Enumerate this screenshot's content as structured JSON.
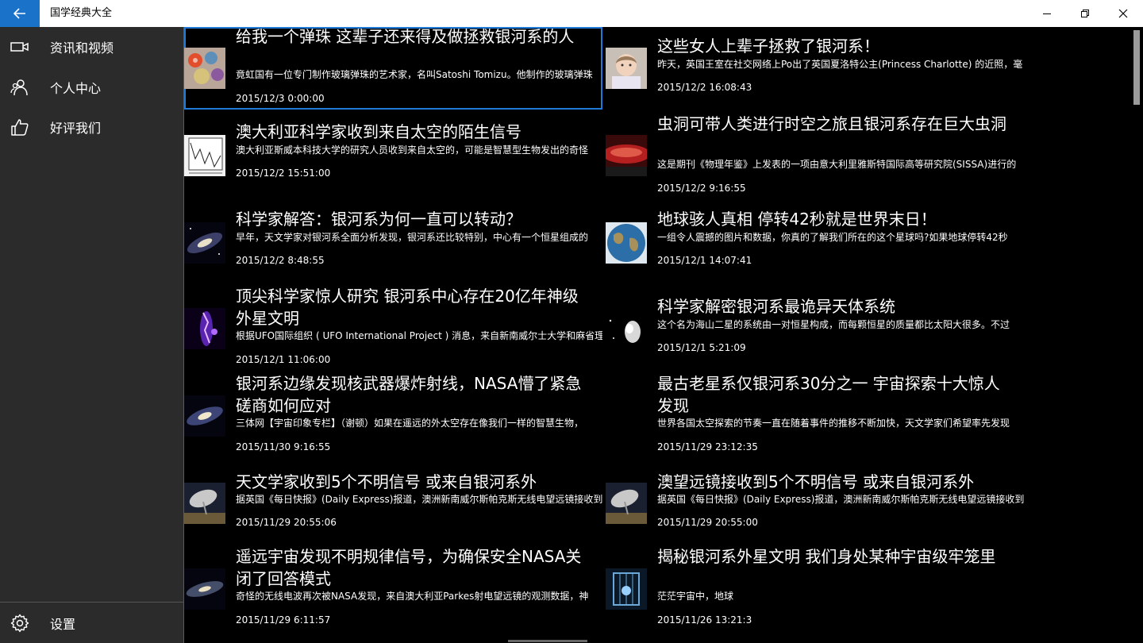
{
  "app": {
    "title": "国学经典大全"
  },
  "nav": [
    {
      "label": "资讯和视频",
      "icon": "video-camera-icon"
    },
    {
      "label": "个人中心",
      "icon": "people-icon"
    },
    {
      "label": "好评我们",
      "icon": "thumbs-up-icon"
    }
  ],
  "settings": {
    "label": "设置",
    "icon": "gear-icon"
  },
  "articles": [
    {
      "title": "给我一个弹珠 这辈子还来得及做拯救银河系的人",
      "summary": "竟虹国有一位专门制作玻璃弹珠的艺术家，名叫Satoshi Tomizu。他制作的玻璃弹珠",
      "date": "2015/12/3 0:00:00",
      "thumb": "marbles"
    },
    {
      "title": "这些女人上辈子拯救了银河系！",
      "summary": "昨天，英国王室在社交网络上Po出了英国夏洛特公主(Princess Charlotte) 的近照，毫",
      "date": "2015/12/2 16:08:43",
      "thumb": "baby"
    },
    {
      "title": "澳大利亚科学家收到来自太空的陌生信号",
      "summary": "澳大利亚斯威本科技大学的研究人员收到来自太空的，可能是智慧型生物发出的奇怪",
      "date": "2015/12/2 15:51:00",
      "thumb": "graph"
    },
    {
      "title": "虫洞可带人类进行时空之旅且银河系存在巨大虫洞",
      "summary": "这是期刊《物理年鉴》上发表的一项由意大利里雅斯特国际高等研究院(SISSA)进行的",
      "date": "2015/12/2 9:16:55",
      "thumb": "wormhole"
    },
    {
      "title": "科学家解答：银河系为何一直可以转动？",
      "summary": "早年，天文学家对银河系全面分析发现，银河系还比较特别，中心有一个恒星组成的",
      "date": "2015/12/2 8:48:55",
      "thumb": "galaxy"
    },
    {
      "title": "地球骇人真相 停转42秒就是世界末日！",
      "summary": "一组令人震撼的图片和数据，你真的了解我们所在的这个星球吗?如果地球停转42秒",
      "date": "2015/12/1 14:07:41",
      "thumb": "earth"
    },
    {
      "title": "顶尖科学家惊人研究 银河系中心存在20亿年神级外星文明",
      "summary": "根据UFO国际组织 ( UFO International Project ) 消息，来自新南威尔士大学和麻省理",
      "date": "2015/12/1 11:06:00",
      "thumb": "purple"
    },
    {
      "title": "科学家解密银河系最诡异天体系统",
      "summary": "这个名为海山二星的系统由一对恒星构成，而每颗恒星的质量都比太阳大很多。不过",
      "date": "2015/12/1 5:21:09",
      "thumb": "nebula"
    },
    {
      "title": "银河系边缘发现核武器爆炸射线，NASA懵了紧急磋商如何应对",
      "summary": "三体网【宇宙印象专栏】（谢顿）如果在遥远的外太空存在像我们一样的智慧生物，",
      "date": "2015/11/30 9:16:55",
      "thumb": "galaxy"
    },
    {
      "title": "最古老星系仅银河系30分之一 宇宙探索十大惊人发现",
      "summary": "世界各国太空探索的节奏一直在随着事件的推移不断加快，天文学家们希望率先发现",
      "date": "2015/11/29 23:12:35",
      "thumb": "none"
    },
    {
      "title": "天文学家收到5个不明信号 或来自银河系外",
      "summary": "据英国《每日快报》(Daily Express)报道，澳洲新南威尔斯帕克斯无线电望远镜接收到",
      "date": "2015/11/29 20:55:06",
      "thumb": "dish"
    },
    {
      "title": "澳望远镜接收到5个不明信号 或来自银河系外",
      "summary": "据英国《每日快报》(Daily Express)报道，澳洲新南威尔斯帕克斯无线电望远镜接收到",
      "date": "2015/11/29 20:55:00",
      "thumb": "dish"
    },
    {
      "title": "遥远宇宙发现不明规律信号，为确保安全NASA关闭了回答模式",
      "summary": "奇怪的无线电波再次被NASA发现，来自澳大利亚Parkes射电望远镜的观测数据，神",
      "date": "2015/11/29 6:11:57",
      "thumb": "galaxy"
    },
    {
      "title": "揭秘银河系外星文明 我们身处某种宇宙级牢笼里",
      "summary": "茫茫宇宙中，地球",
      "date": "2015/11/26 13:21:3",
      "thumb": "cage"
    }
  ]
}
